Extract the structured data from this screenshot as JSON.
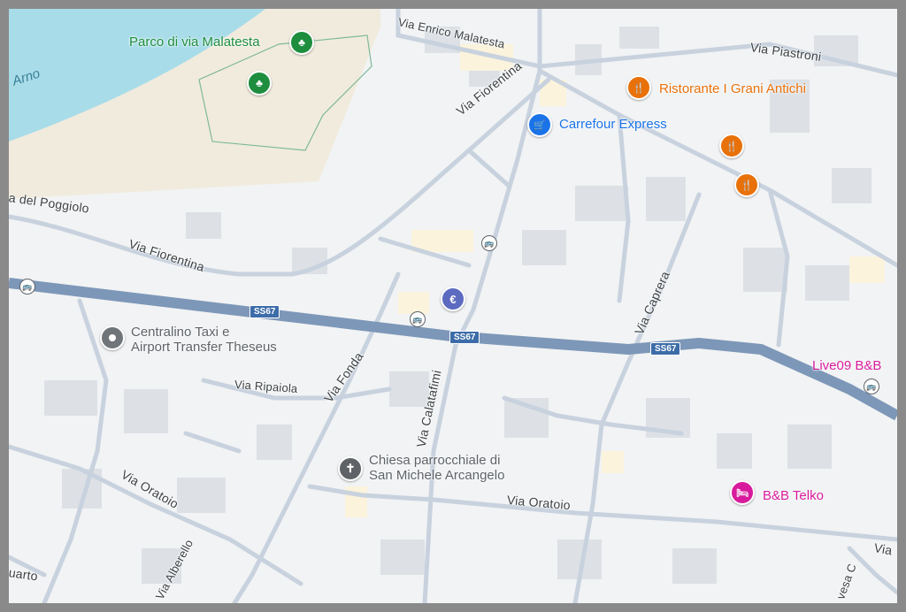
{
  "map": {
    "river_label": "Arno",
    "streets": {
      "enrico_malatesta": "Via Enrico Malatesta",
      "piastroni": "Via Piastroni",
      "fiorentina_upper": "Via Fiorentina",
      "fiorentina_lower": "Via Fiorentina",
      "poggiolo": "a del Poggiolo",
      "caprera": "Via Caprera",
      "fonda": "Via Fonda",
      "ripaiola": "Via Ripaiola",
      "calatafimi": "Via Calatafimi",
      "oratoio_left": "Via Oratoio",
      "oratoio_right": "Via Oratoio",
      "alberello": "Via Alberello",
      "quarto": "uarto",
      "vesa": "vesa C",
      "via_right": "Via"
    },
    "road_shields": [
      "SS67",
      "SS67",
      "SS67"
    ],
    "pois": {
      "parco": {
        "name": "Parco di via Malatesta",
        "icon": "tree-icon",
        "color": "#1e8e3e"
      },
      "ristorante": {
        "name": "Ristorante I Grani Antichi",
        "icon": "restaurant-icon",
        "color": "#e8710a"
      },
      "carrefour": {
        "name": "Carrefour Express",
        "icon": "shopping-cart-icon",
        "color": "#1a73e8"
      },
      "taxi": {
        "name": "Centralino Taxi e Airport Transfer Theseus",
        "line1": "Centralino Taxi e",
        "line2": "Airport Transfer Theseus",
        "icon": "location-pin-icon",
        "color": "#70757a"
      },
      "chiesa": {
        "name": "Chiesa parrocchiale di San Michele Arcangelo",
        "line1": "Chiesa parrocchiale di",
        "line2": "San Michele Arcangelo",
        "icon": "church-cross-icon",
        "color": "#5f6368"
      },
      "live09": {
        "name": "Live09 B&B",
        "color": "#d81b9c"
      },
      "telko": {
        "name": "B&B Telko",
        "icon": "bed-icon",
        "color": "#d81b9c"
      }
    },
    "icons": {
      "euro": "€",
      "restaurant": "🍴",
      "bus": "🚌",
      "cart": "🛒",
      "tree": "♣",
      "cross": "✝",
      "bed": "🛏"
    },
    "colors": {
      "water": "#a8dce9",
      "park": "#f1ebdd",
      "highway": "#7d97b8",
      "road": "#c8d2de",
      "building": "#dde1e6",
      "background": "#f1f3f4"
    }
  }
}
